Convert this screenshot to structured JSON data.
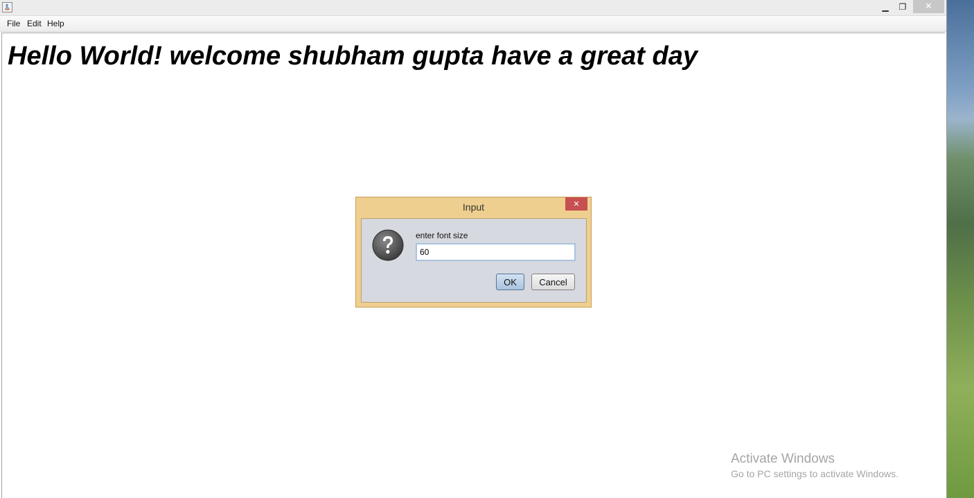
{
  "window": {
    "controls": {
      "minimize": "▁",
      "maximize": "❐",
      "close": "✕"
    }
  },
  "menubar": {
    "items": [
      {
        "label": "File"
      },
      {
        "label": "Edit"
      },
      {
        "label": "Help"
      }
    ]
  },
  "content": {
    "message": "Hello World! welcome shubham gupta have a great day"
  },
  "dialog": {
    "title": "Input",
    "close": "✕",
    "prompt": "enter font size",
    "input_value": "60",
    "ok_label": "OK",
    "cancel_label": "Cancel",
    "icon": "question-icon"
  },
  "watermark": {
    "title": "Activate Windows",
    "subtitle": "Go to PC settings to activate Windows."
  }
}
